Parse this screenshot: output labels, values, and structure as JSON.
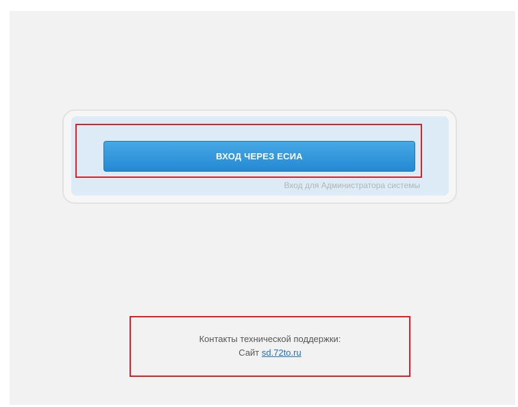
{
  "login": {
    "esia_button_label": "ВХОД ЧЕРЕЗ ЕСИА",
    "admin_login_label": "Вход для Администратора системы"
  },
  "support": {
    "heading": "Контакты технической поддержки:",
    "site_label": "Сайт",
    "site_link": "sd.72to.ru"
  },
  "colors": {
    "button": "#2389d3",
    "panel": "#dcebf6",
    "highlight": "#e01e24",
    "link": "#1f6fc5"
  }
}
